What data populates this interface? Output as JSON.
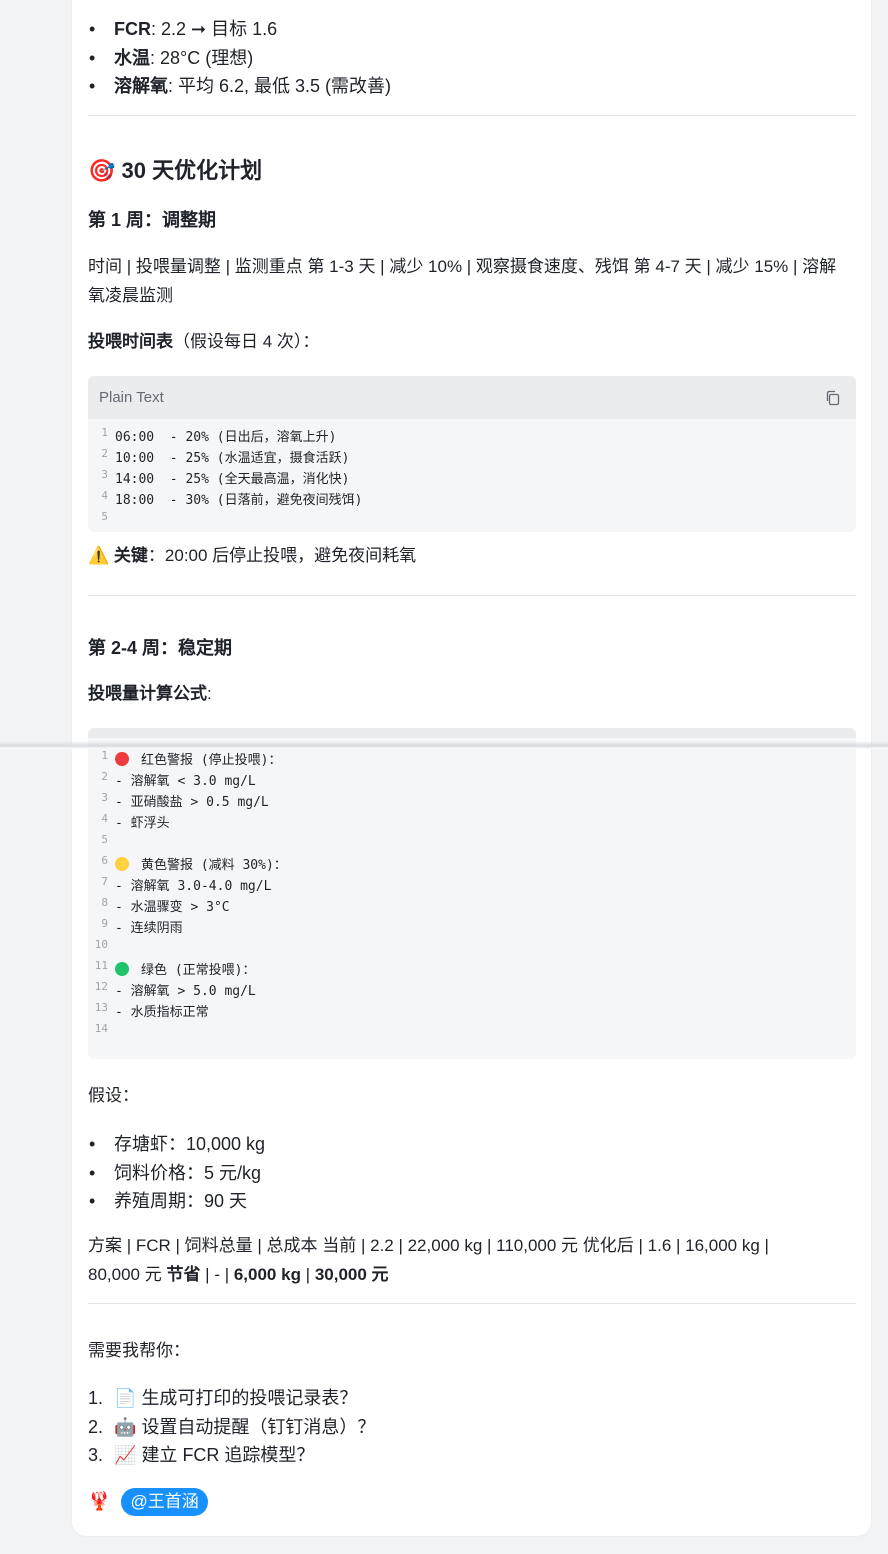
{
  "top_bullets": [
    {
      "label": "FCR",
      "text": ": 2.2 ➞ 目标 1.6"
    },
    {
      "label": "水温",
      "text": ": 28°C (理想)"
    },
    {
      "label": "溶解氧",
      "text": ": 平均 6.2, 最低 3.5 (需改善)"
    }
  ],
  "plan": {
    "icon": "🎯",
    "title": "30 天优化计划",
    "week1_title": "第 1 周：调整期",
    "week1_table_text": "时间 | 投喂量调整 | 监测重点 第 1-3 天 | 减少 10% | 观察摄食速度、残饵 第 4-7 天 | 减少 15% | 溶解氧凌晨监测",
    "schedule_label": "投喂时间表",
    "schedule_note": "（假设每日 4 次）："
  },
  "code1": {
    "lang": "Plain Text",
    "lines": [
      "06:00  - 20% (日出后，溶氧上升)",
      "10:00  - 25% (水温适宜，摄食活跃)",
      "14:00  - 25% (全天最高温，消化快)",
      "18:00  - 30% (日落前，避免夜间残饵)",
      ""
    ]
  },
  "warning": {
    "icon": "⚠️",
    "label": "关键",
    "text": "：20:00 后停止投喂，避免夜间耗氧"
  },
  "week2": {
    "title": "第 2-4 周：稳定期",
    "formula_label": "投喂量计算公式",
    "formula_colon": ":"
  },
  "code2": {
    "lines": [
      {
        "dot": "#ee3b3b",
        "text": "红色警报 (停止投喂)："
      },
      {
        "text": "- 溶解氧 < 3.0 mg/L"
      },
      {
        "text": "- 亚硝酸盐 > 0.5 mg/L"
      },
      {
        "text": "- 虾浮头"
      },
      {
        "text": ""
      },
      {
        "dot": "#fdd23e",
        "text": "黄色警报 (减料 30%)："
      },
      {
        "text": "- 溶解氧 3.0-4.0 mg/L"
      },
      {
        "text": "- 水温骤变 > 3°C"
      },
      {
        "text": "- 连续阴雨"
      },
      {
        "text": ""
      },
      {
        "dot": "#1fc46a",
        "text": "绿色 (正常投喂)："
      },
      {
        "text": "- 溶解氧 > 5.0 mg/L"
      },
      {
        "text": "- 水质指标正常"
      },
      {
        "text": ""
      }
    ],
    "line_numbers": [
      "1",
      "2",
      "3",
      "4",
      "5",
      "6",
      "7",
      "8",
      "9",
      "10",
      "11",
      "12",
      "13",
      "14"
    ]
  },
  "assume": {
    "title": "假设：",
    "items": [
      "存塘虾：10,000 kg",
      "饲料价格：5 元/kg",
      "养殖周期：90 天"
    ]
  },
  "compare": {
    "text": "方案 | FCR | 饲料总量 | 总成本 当前 | 2.2 | 22,000 kg | 110,000 元 优化后 | 1.6 | 16,000 kg |",
    "line2_prefix": "80,000 元 ",
    "saving_label": "节省",
    "mid": " | - | ",
    "saving_kg": "6,000 kg",
    "sep": " | ",
    "saving_money": "30,000 元"
  },
  "help": {
    "title": "需要我帮你：",
    "items": [
      {
        "num": "1.",
        "icon": "📄",
        "text": "生成可打印的投喂记录表？"
      },
      {
        "num": "2.",
        "icon": "🤖",
        "text": "设置自动提醒（钉钉消息）？"
      },
      {
        "num": "3.",
        "icon": "📈",
        "text": "建立 FCR 追踪模型？"
      }
    ]
  },
  "footer": {
    "icon": "🦞",
    "mention": "@王首涵"
  }
}
